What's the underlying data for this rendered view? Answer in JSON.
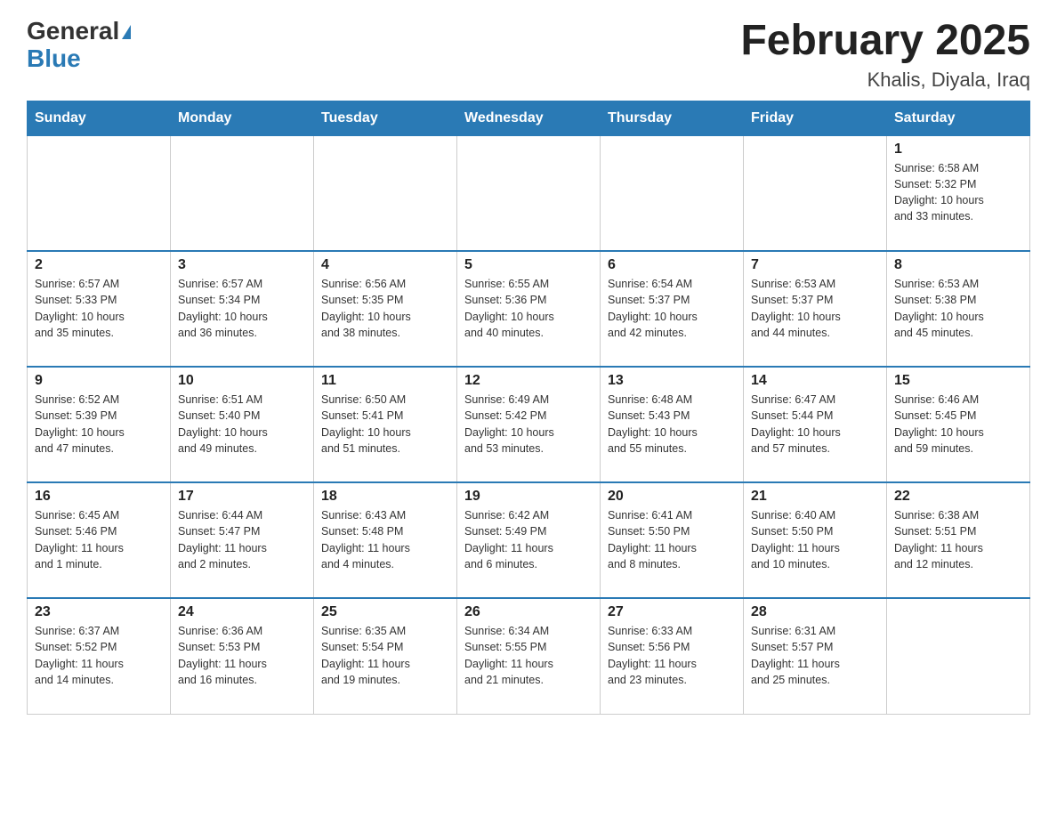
{
  "logo": {
    "general": "General",
    "blue": "Blue",
    "triangle": "▲"
  },
  "title": "February 2025",
  "subtitle": "Khalis, Diyala, Iraq",
  "days_header": [
    "Sunday",
    "Monday",
    "Tuesday",
    "Wednesday",
    "Thursday",
    "Friday",
    "Saturday"
  ],
  "weeks": [
    [
      {
        "day": "",
        "info": ""
      },
      {
        "day": "",
        "info": ""
      },
      {
        "day": "",
        "info": ""
      },
      {
        "day": "",
        "info": ""
      },
      {
        "day": "",
        "info": ""
      },
      {
        "day": "",
        "info": ""
      },
      {
        "day": "1",
        "info": "Sunrise: 6:58 AM\nSunset: 5:32 PM\nDaylight: 10 hours\nand 33 minutes."
      }
    ],
    [
      {
        "day": "2",
        "info": "Sunrise: 6:57 AM\nSunset: 5:33 PM\nDaylight: 10 hours\nand 35 minutes."
      },
      {
        "day": "3",
        "info": "Sunrise: 6:57 AM\nSunset: 5:34 PM\nDaylight: 10 hours\nand 36 minutes."
      },
      {
        "day": "4",
        "info": "Sunrise: 6:56 AM\nSunset: 5:35 PM\nDaylight: 10 hours\nand 38 minutes."
      },
      {
        "day": "5",
        "info": "Sunrise: 6:55 AM\nSunset: 5:36 PM\nDaylight: 10 hours\nand 40 minutes."
      },
      {
        "day": "6",
        "info": "Sunrise: 6:54 AM\nSunset: 5:37 PM\nDaylight: 10 hours\nand 42 minutes."
      },
      {
        "day": "7",
        "info": "Sunrise: 6:53 AM\nSunset: 5:37 PM\nDaylight: 10 hours\nand 44 minutes."
      },
      {
        "day": "8",
        "info": "Sunrise: 6:53 AM\nSunset: 5:38 PM\nDaylight: 10 hours\nand 45 minutes."
      }
    ],
    [
      {
        "day": "9",
        "info": "Sunrise: 6:52 AM\nSunset: 5:39 PM\nDaylight: 10 hours\nand 47 minutes."
      },
      {
        "day": "10",
        "info": "Sunrise: 6:51 AM\nSunset: 5:40 PM\nDaylight: 10 hours\nand 49 minutes."
      },
      {
        "day": "11",
        "info": "Sunrise: 6:50 AM\nSunset: 5:41 PM\nDaylight: 10 hours\nand 51 minutes."
      },
      {
        "day": "12",
        "info": "Sunrise: 6:49 AM\nSunset: 5:42 PM\nDaylight: 10 hours\nand 53 minutes."
      },
      {
        "day": "13",
        "info": "Sunrise: 6:48 AM\nSunset: 5:43 PM\nDaylight: 10 hours\nand 55 minutes."
      },
      {
        "day": "14",
        "info": "Sunrise: 6:47 AM\nSunset: 5:44 PM\nDaylight: 10 hours\nand 57 minutes."
      },
      {
        "day": "15",
        "info": "Sunrise: 6:46 AM\nSunset: 5:45 PM\nDaylight: 10 hours\nand 59 minutes."
      }
    ],
    [
      {
        "day": "16",
        "info": "Sunrise: 6:45 AM\nSunset: 5:46 PM\nDaylight: 11 hours\nand 1 minute."
      },
      {
        "day": "17",
        "info": "Sunrise: 6:44 AM\nSunset: 5:47 PM\nDaylight: 11 hours\nand 2 minutes."
      },
      {
        "day": "18",
        "info": "Sunrise: 6:43 AM\nSunset: 5:48 PM\nDaylight: 11 hours\nand 4 minutes."
      },
      {
        "day": "19",
        "info": "Sunrise: 6:42 AM\nSunset: 5:49 PM\nDaylight: 11 hours\nand 6 minutes."
      },
      {
        "day": "20",
        "info": "Sunrise: 6:41 AM\nSunset: 5:50 PM\nDaylight: 11 hours\nand 8 minutes."
      },
      {
        "day": "21",
        "info": "Sunrise: 6:40 AM\nSunset: 5:50 PM\nDaylight: 11 hours\nand 10 minutes."
      },
      {
        "day": "22",
        "info": "Sunrise: 6:38 AM\nSunset: 5:51 PM\nDaylight: 11 hours\nand 12 minutes."
      }
    ],
    [
      {
        "day": "23",
        "info": "Sunrise: 6:37 AM\nSunset: 5:52 PM\nDaylight: 11 hours\nand 14 minutes."
      },
      {
        "day": "24",
        "info": "Sunrise: 6:36 AM\nSunset: 5:53 PM\nDaylight: 11 hours\nand 16 minutes."
      },
      {
        "day": "25",
        "info": "Sunrise: 6:35 AM\nSunset: 5:54 PM\nDaylight: 11 hours\nand 19 minutes."
      },
      {
        "day": "26",
        "info": "Sunrise: 6:34 AM\nSunset: 5:55 PM\nDaylight: 11 hours\nand 21 minutes."
      },
      {
        "day": "27",
        "info": "Sunrise: 6:33 AM\nSunset: 5:56 PM\nDaylight: 11 hours\nand 23 minutes."
      },
      {
        "day": "28",
        "info": "Sunrise: 6:31 AM\nSunset: 5:57 PM\nDaylight: 11 hours\nand 25 minutes."
      },
      {
        "day": "",
        "info": ""
      }
    ]
  ]
}
